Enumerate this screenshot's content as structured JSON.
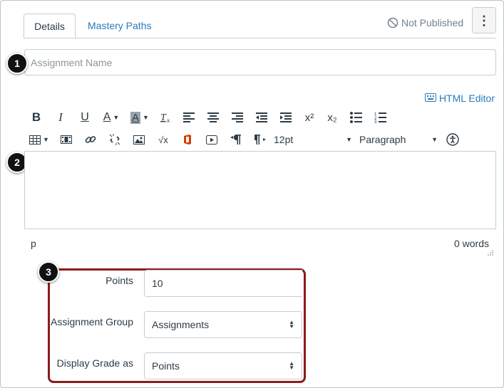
{
  "tabs": [
    {
      "label": "Details",
      "active": true
    },
    {
      "label": "Mastery Paths",
      "active": false
    }
  ],
  "publish_status": "Not Published",
  "assignment_name": {
    "value": "",
    "placeholder": "Assignment Name"
  },
  "html_editor_label": "HTML Editor",
  "toolbar": {
    "font_size": "12pt",
    "block_format": "Paragraph",
    "superscript_label": "x²",
    "subscript_label": "x₂",
    "sqrt_label": "√x"
  },
  "editor": {
    "status_path": "p",
    "word_count": "0 words"
  },
  "options": {
    "points_label": "Points",
    "points_value": "10",
    "group_label": "Assignment Group",
    "group_value": "Assignments",
    "display_label": "Display Grade as",
    "display_value": "Points"
  },
  "markers": [
    "1",
    "2",
    "3"
  ],
  "colors": {
    "link": "#2b7abc",
    "highlight_border": "#8c1a1a",
    "text": "#2d3b45",
    "office_icon": "#d83b01"
  }
}
